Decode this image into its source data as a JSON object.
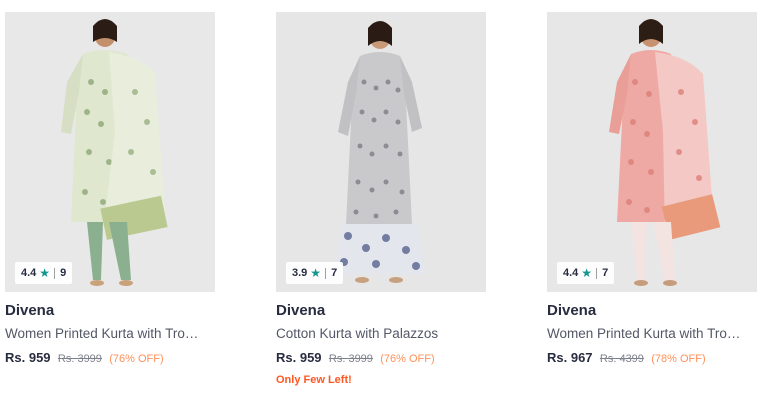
{
  "products": [
    {
      "brand": "Divena",
      "title": "Women Printed Kurta with Tro…",
      "price": "Rs. 959",
      "mrp": "Rs. 3999",
      "discount": "(76% OFF)",
      "rating": "4.4",
      "rating_count": "9",
      "stock_note": "",
      "outfit_colors": {
        "kurta": "#dfe7cf",
        "print": "#8fa877",
        "dupatta": "#e8eddc",
        "bottom": "#8bb08f",
        "border": "#b9c98f"
      }
    },
    {
      "brand": "Divena",
      "title": "Cotton Kurta with Palazzos",
      "price": "Rs. 959",
      "mrp": "Rs. 3999",
      "discount": "(76% OFF)",
      "rating": "3.9",
      "rating_count": "7",
      "stock_note": "Only Few Left!",
      "outfit_colors": {
        "kurta": "#c9c9cc",
        "print": "#5a5d66",
        "dupatta": "",
        "bottom": "#e4e6ee",
        "border": "#4c5b86"
      }
    },
    {
      "brand": "Divena",
      "title": "Women Printed Kurta with Tro…",
      "price": "Rs. 967",
      "mrp": "Rs. 4399",
      "discount": "(78% OFF)",
      "rating": "4.4",
      "rating_count": "7",
      "stock_note": "",
      "outfit_colors": {
        "kurta": "#efa9a4",
        "print": "#d9756f",
        "dupatta": "#f4c8c4",
        "bottom": "#f3e3e1",
        "border": "#e89a7a"
      }
    }
  ],
  "icons": {
    "rating_star": "star-icon"
  },
  "accent": {
    "rating_star": "#14958f",
    "discount": "#ff905a",
    "stock_note": "#ff5722"
  }
}
